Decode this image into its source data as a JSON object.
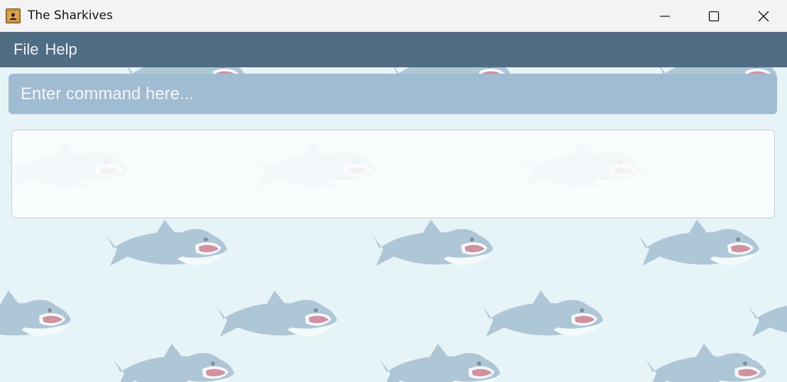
{
  "window": {
    "title": "The Sharkives",
    "controls": {
      "minimize_icon": "minimize-icon",
      "maximize_icon": "maximize-icon",
      "close_icon": "close-icon"
    }
  },
  "menu": {
    "items": [
      {
        "label": "File"
      },
      {
        "label": "Help"
      }
    ]
  },
  "command": {
    "value": "",
    "placeholder": "Enter command here..."
  },
  "result": {
    "text": ""
  },
  "colors": {
    "menubar": "#516d84",
    "command_box": "#a0bcd3",
    "background": "#e6f3f7"
  }
}
